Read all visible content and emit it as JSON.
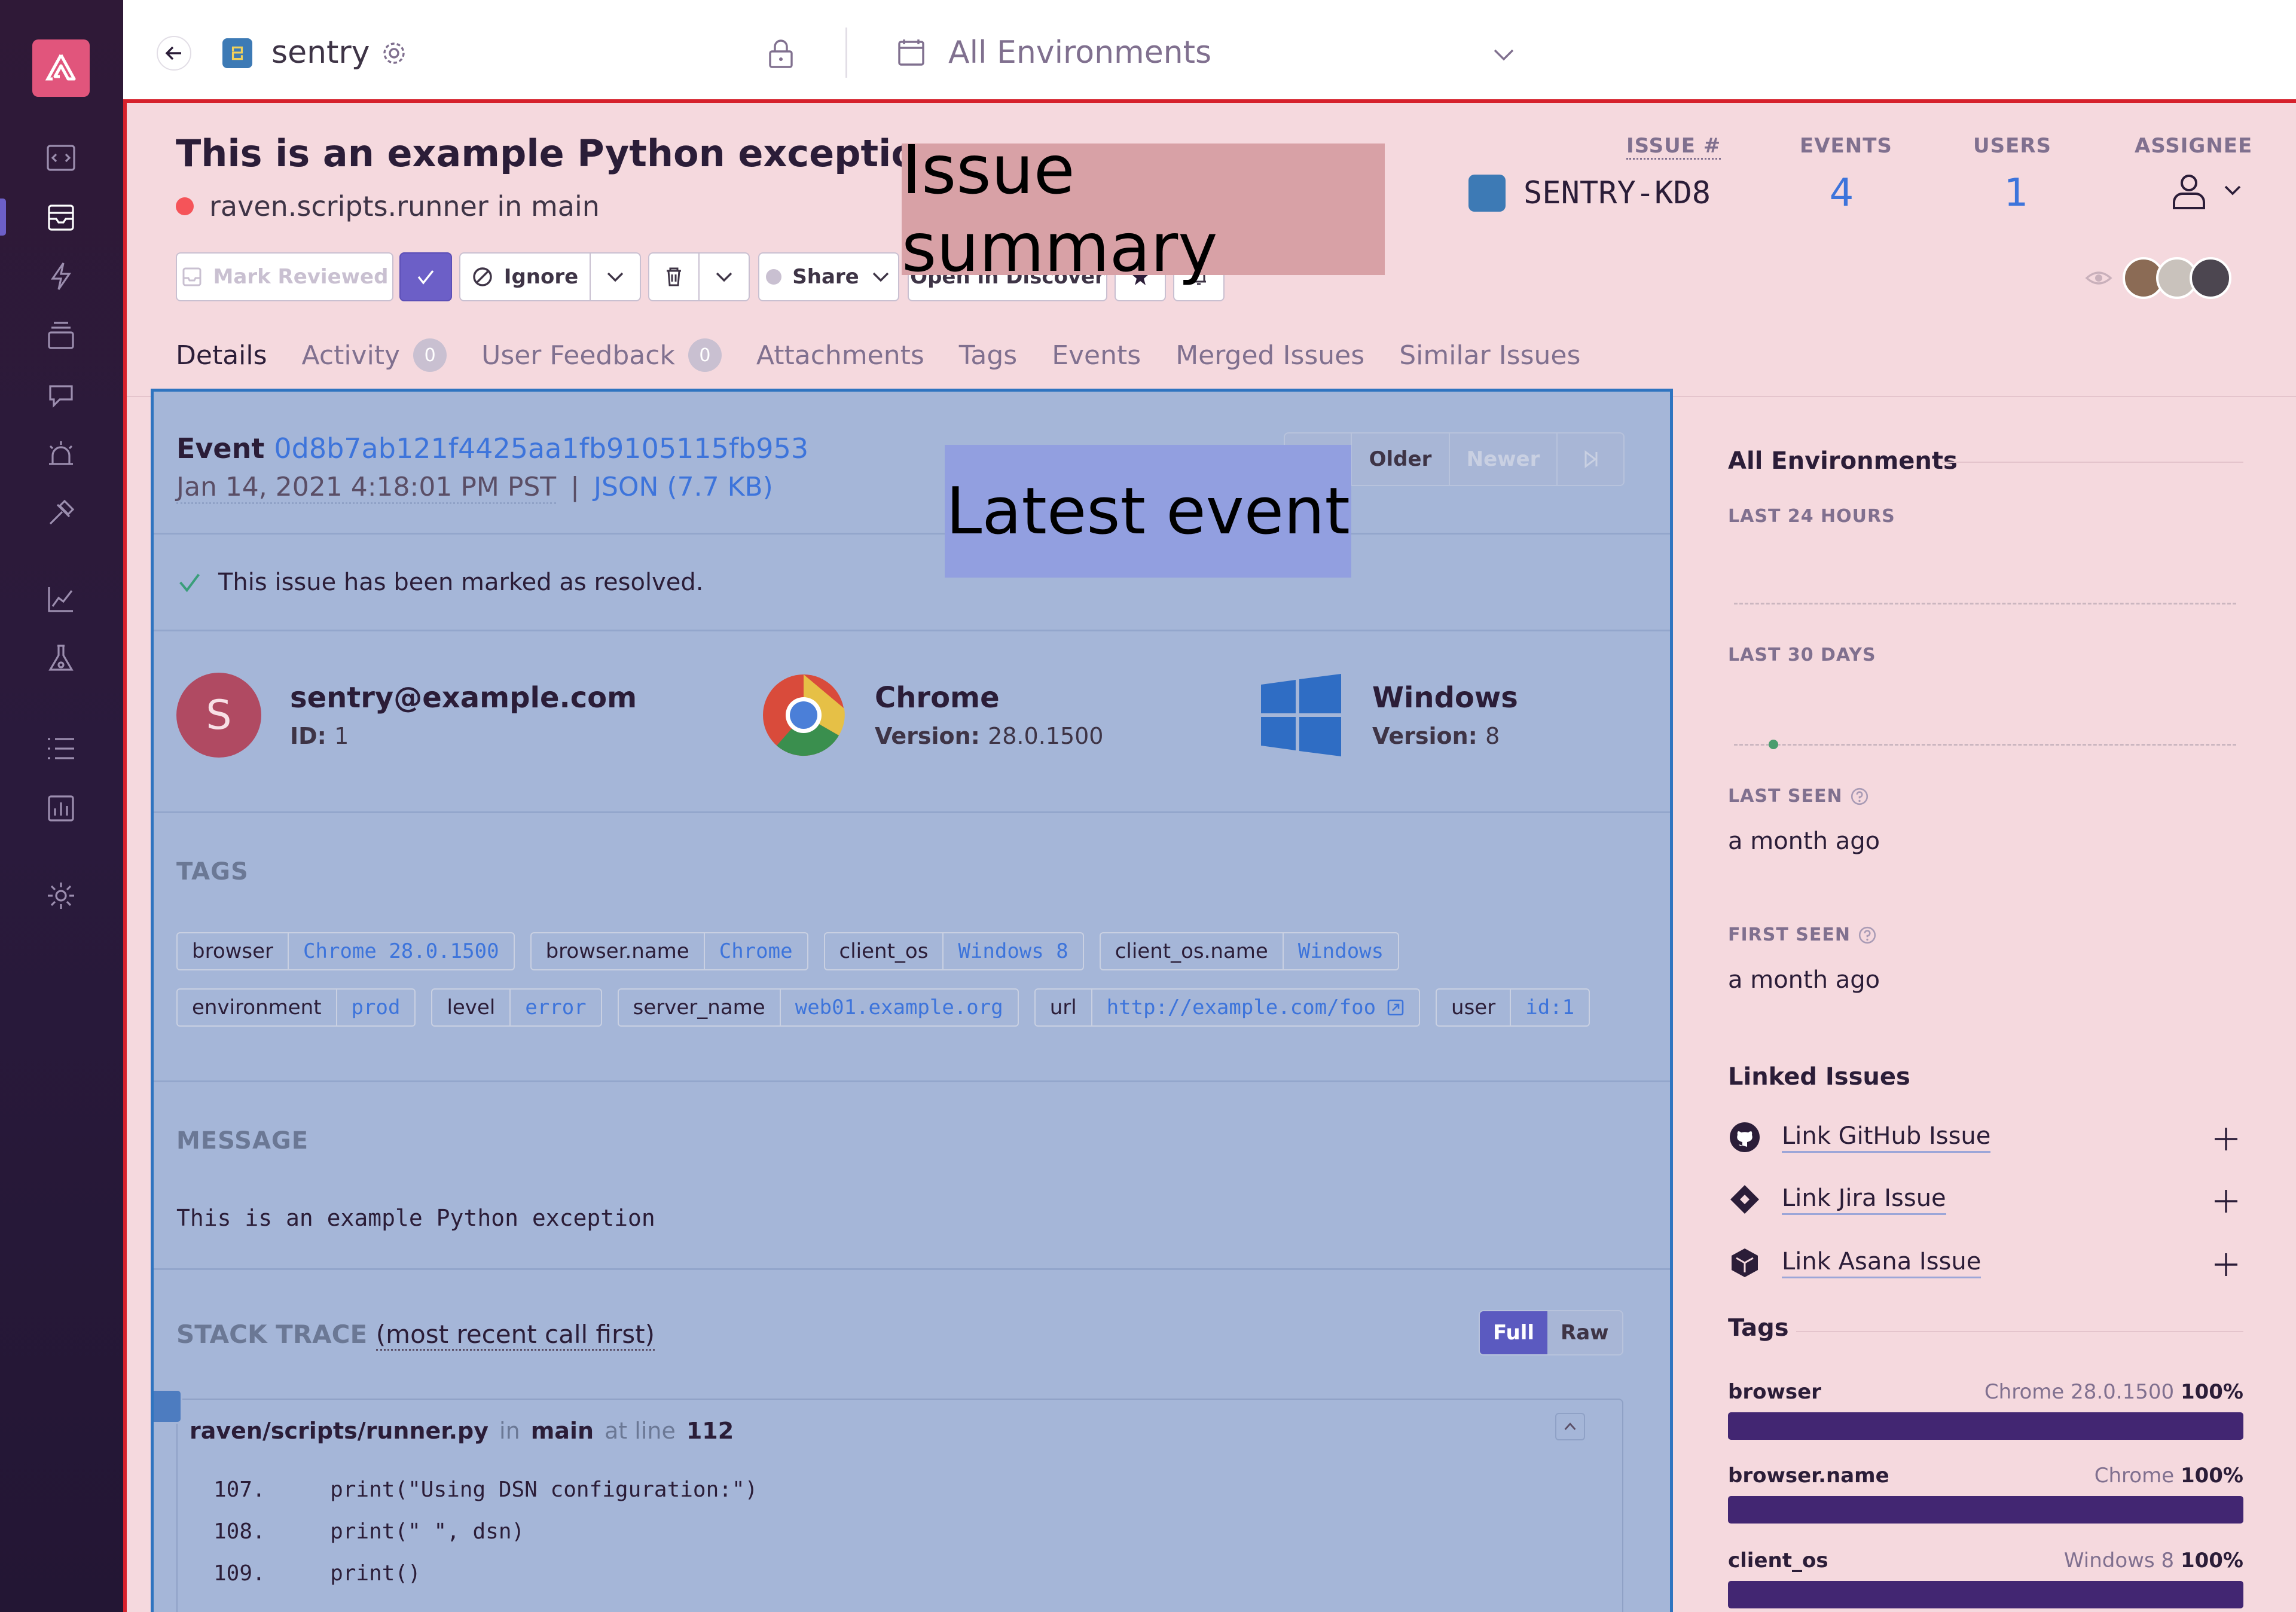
{
  "topbar": {
    "project_name": "sentry",
    "environment": "All Environments"
  },
  "issue": {
    "title": "This is an example Python exception",
    "culprit": "raven.scripts.runner in main",
    "issue_num_label": "ISSUE #",
    "issue_num": "SENTRY-KD8",
    "events_label": "EVENTS",
    "events": "4",
    "users_label": "USERS",
    "users": "1",
    "assignee_label": "ASSIGNEE"
  },
  "actions": {
    "mark_reviewed": "Mark Reviewed",
    "ignore": "Ignore",
    "share": "Share",
    "open_discover": "Open in Discover"
  },
  "tabs": [
    {
      "label": "Details"
    },
    {
      "label": "Activity",
      "badge": "0"
    },
    {
      "label": "User Feedback",
      "badge": "0"
    },
    {
      "label": "Attachments"
    },
    {
      "label": "Tags"
    },
    {
      "label": "Events"
    },
    {
      "label": "Merged Issues"
    },
    {
      "label": "Similar Issues"
    }
  ],
  "annotations": {
    "issue_summary": "Issue summary",
    "latest_event": "Latest event"
  },
  "event": {
    "prefix": "Event",
    "id": "0d8b7ab121f4425aa1fb9105115fb953",
    "date": "Jan 14, 2021 4:18:01 PM PST",
    "json": "JSON (7.7 KB)",
    "older": "Older",
    "newer": "Newer",
    "resolved_msg": "This issue has been marked as resolved."
  },
  "context": {
    "user": {
      "avatar_letter": "S",
      "title": "sentry@example.com",
      "sub_label": "ID:",
      "sub_value": "1"
    },
    "browser": {
      "title": "Chrome",
      "sub_label": "Version:",
      "sub_value": "28.0.1500"
    },
    "os": {
      "title": "Windows",
      "sub_label": "Version:",
      "sub_value": "8"
    }
  },
  "tags_title": "TAGS",
  "tags_row1": [
    {
      "k": "browser",
      "v": "Chrome 28.0.1500"
    },
    {
      "k": "browser.name",
      "v": "Chrome"
    },
    {
      "k": "client_os",
      "v": "Windows 8"
    },
    {
      "k": "client_os.name",
      "v": "Windows"
    }
  ],
  "tags_row2": [
    {
      "k": "environment",
      "v": "prod"
    },
    {
      "k": "level",
      "v": "error"
    },
    {
      "k": "server_name",
      "v": "web01.example.org"
    },
    {
      "k": "url",
      "v": "http://example.com/foo"
    },
    {
      "k": "user",
      "v": "id:1"
    }
  ],
  "message_title": "MESSAGE",
  "message": "This is an example Python exception",
  "stack": {
    "title": "STACK TRACE",
    "subtitle": "(most recent call first)",
    "full": "Full",
    "raw": "Raw",
    "file": "raven/scripts/runner.py",
    "in": "in",
    "func": "main",
    "at_line": "at line",
    "line": "112",
    "lines": [
      "107.     print(\"Using DSN configuration:\")",
      "108.     print(\" \", dsn)",
      "109.     print()"
    ]
  },
  "sidebar": {
    "env_title": "All Environments",
    "last24": "LAST 24 HOURS",
    "last30": "LAST 30 DAYS",
    "last_seen_label": "LAST SEEN",
    "last_seen": "a month ago",
    "first_seen_label": "FIRST SEEN",
    "first_seen": "a month ago",
    "linked_title": "Linked Issues",
    "links": [
      "Link GitHub Issue",
      "Link Jira Issue",
      "Link Asana Issue"
    ],
    "tags_title": "Tags",
    "tag_dist": [
      {
        "k": "browser",
        "v": "Chrome 28.0.1500",
        "pct": "100%"
      },
      {
        "k": "browser.name",
        "v": "Chrome",
        "pct": "100%"
      },
      {
        "k": "client_os",
        "v": "Windows 8",
        "pct": "100%"
      }
    ]
  }
}
